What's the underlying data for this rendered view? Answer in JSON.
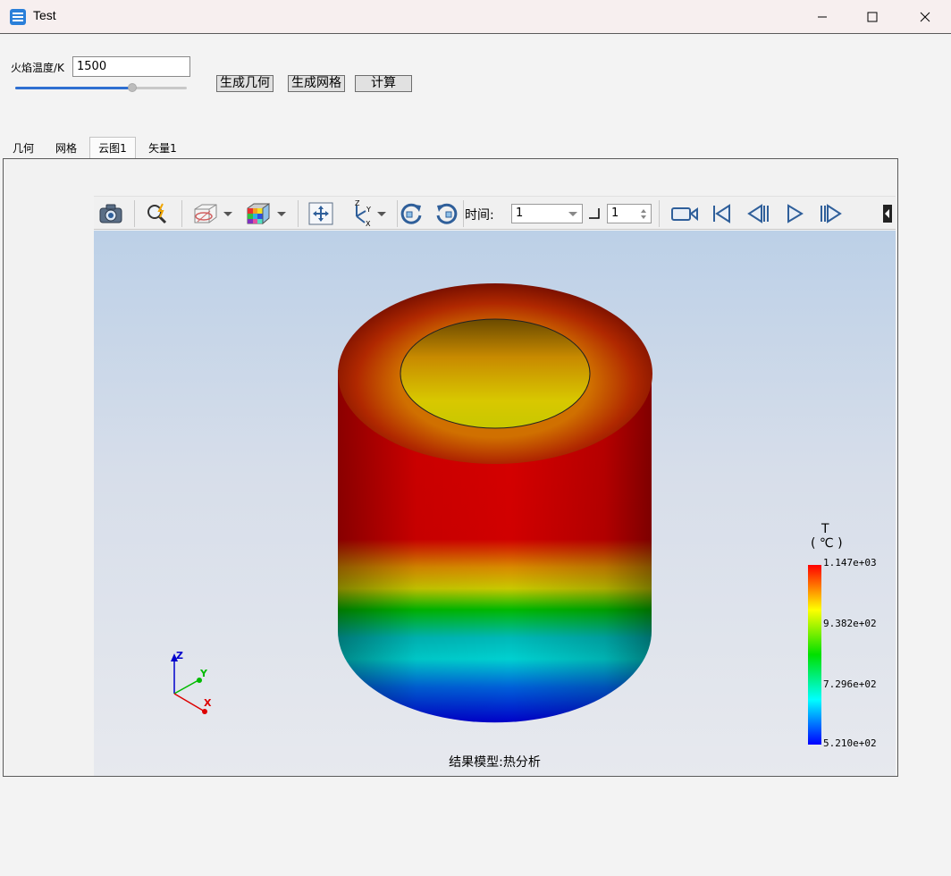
{
  "window": {
    "title": "Test"
  },
  "controls": {
    "temperature_label": "火焰温度/K",
    "temperature_value": "1500",
    "temperature_slider_fraction": 0.68,
    "buttons": {
      "geometry": "生成几何",
      "mesh": "生成网格",
      "compute": "计算"
    }
  },
  "tabs": [
    {
      "label": "几何"
    },
    {
      "label": "网格"
    },
    {
      "label": "云图1",
      "active": true
    },
    {
      "label": "矢量1"
    }
  ],
  "toolbar": {
    "time_label": "时间:",
    "time_value": "1",
    "step_value": "1",
    "icons": [
      "camera-icon",
      "zoom-icon",
      "display-mode-icon",
      "color-cube-icon",
      "fit-view-icon",
      "axes-icon",
      "rotate-cw-icon",
      "rotate-ccw-icon",
      "record-icon",
      "first-frame-icon",
      "prev-frame-icon",
      "play-icon",
      "next-frame-icon",
      "more-icon"
    ]
  },
  "viewport": {
    "caption": "结果模型:热分析",
    "axis_labels": {
      "x": "X",
      "y": "Y",
      "z": "Z"
    },
    "legend": {
      "title": "T",
      "unit": "( ℃ )",
      "labels": [
        "1.147e+03",
        "9.382e+02",
        "7.296e+02",
        "5.210e+02"
      ],
      "colors": [
        "#ff0000",
        "#ffff00",
        "#00e000",
        "#00ffff",
        "#0000ff"
      ]
    }
  }
}
